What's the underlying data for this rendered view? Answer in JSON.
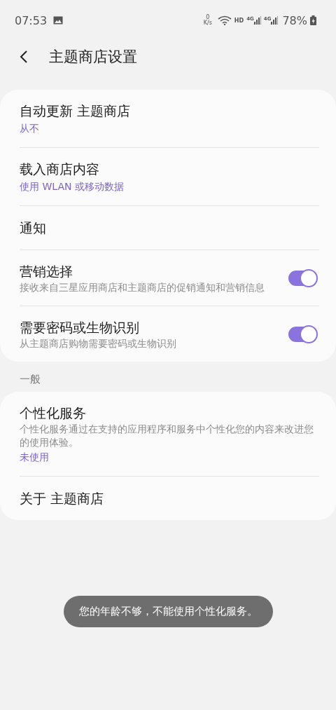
{
  "status_bar": {
    "time": "07:53",
    "net_speed_value": "0",
    "net_speed_unit": "K/s",
    "hd": "HD",
    "networks": [
      "4G",
      "4G"
    ],
    "battery": "78%"
  },
  "header": {
    "title": "主题商店设置"
  },
  "sections": [
    {
      "items": [
        {
          "title": "自动更新 主题商店",
          "value": "从不"
        },
        {
          "title": "载入商店内容",
          "value": "使用 WLAN 或移动数据"
        },
        {
          "title": "通知"
        },
        {
          "title": "营销选择",
          "description": "接收来自三星应用商店和主题商店的促销通知和营销信息",
          "toggle": {
            "on": true
          }
        },
        {
          "title": "需要密码或生物识别",
          "description": "从主题商店购物需要密码或生物识别",
          "toggle": {
            "on": true
          }
        }
      ]
    },
    {
      "heading": "一般",
      "items": [
        {
          "title": "个性化服务",
          "description": "个性化服务通过在支持的应用程序和服务中个性化您的内容来改进您的使用体验。",
          "value": "未使用"
        },
        {
          "title": "关于 主题商店"
        }
      ]
    }
  ],
  "toast": "您的年龄不够，不能使用个性化服务。"
}
